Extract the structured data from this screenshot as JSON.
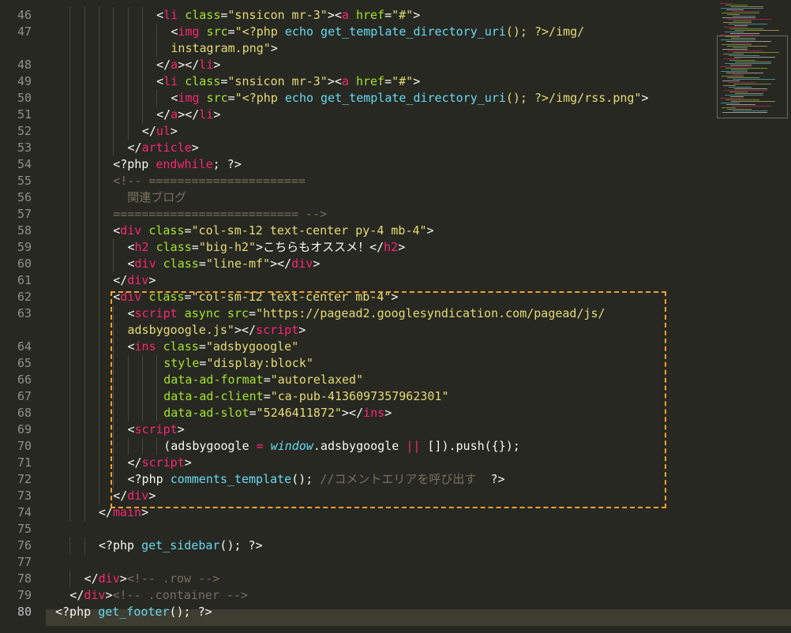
{
  "editor": {
    "line_numbers": [
      "46",
      "47",
      "",
      "48",
      "49",
      "50",
      "51",
      "52",
      "53",
      "54",
      "55",
      "56",
      "57",
      "58",
      "59",
      "60",
      "61",
      "62",
      "63",
      "",
      "64",
      "65",
      "66",
      "67",
      "68",
      "69",
      "70",
      "71",
      "72",
      "73",
      "74",
      "75",
      "76",
      "77",
      "78",
      "79",
      "80"
    ],
    "current_line": "80"
  },
  "code": [
    {
      "indent": 14,
      "tokens": [
        [
          "w",
          "<"
        ],
        [
          "t",
          "li"
        ],
        [
          "a",
          " class"
        ],
        [
          "w",
          "="
        ],
        [
          "s",
          "\"snsicon mr-3\""
        ],
        [
          "w",
          "><"
        ],
        [
          "t",
          "a"
        ],
        [
          "a",
          " href"
        ],
        [
          "w",
          "="
        ],
        [
          "s",
          "\"#\""
        ],
        [
          "w",
          ">"
        ]
      ]
    },
    {
      "indent": 16,
      "tokens": [
        [
          "w",
          "<"
        ],
        [
          "t",
          "img"
        ],
        [
          "a",
          " src"
        ],
        [
          "w",
          "="
        ],
        [
          "s",
          "\"<?php "
        ],
        [
          "f",
          "echo"
        ],
        [
          "s",
          " "
        ],
        [
          "f",
          "get_template_directory_uri"
        ],
        [
          "s",
          "(); ?>/img/"
        ]
      ]
    },
    {
      "indent": 16,
      "tokens": [
        [
          "s",
          "instagram.png\""
        ],
        [
          "w",
          ">"
        ]
      ]
    },
    {
      "indent": 14,
      "tokens": [
        [
          "w",
          "</"
        ],
        [
          "t",
          "a"
        ],
        [
          "w",
          "></"
        ],
        [
          "t",
          "li"
        ],
        [
          "w",
          ">"
        ]
      ]
    },
    {
      "indent": 14,
      "tokens": [
        [
          "w",
          "<"
        ],
        [
          "t",
          "li"
        ],
        [
          "a",
          " class"
        ],
        [
          "w",
          "="
        ],
        [
          "s",
          "\"snsicon mr-3\""
        ],
        [
          "w",
          "><"
        ],
        [
          "t",
          "a"
        ],
        [
          "a",
          " href"
        ],
        [
          "w",
          "="
        ],
        [
          "s",
          "\"#\""
        ],
        [
          "w",
          ">"
        ]
      ]
    },
    {
      "indent": 16,
      "tokens": [
        [
          "w",
          "<"
        ],
        [
          "t",
          "img"
        ],
        [
          "a",
          " src"
        ],
        [
          "w",
          "="
        ],
        [
          "s",
          "\"<?php "
        ],
        [
          "f",
          "echo"
        ],
        [
          "s",
          " "
        ],
        [
          "f",
          "get_template_directory_uri"
        ],
        [
          "s",
          "(); ?>/img/rss.png\""
        ],
        [
          "w",
          ">"
        ]
      ]
    },
    {
      "indent": 14,
      "tokens": [
        [
          "w",
          "</"
        ],
        [
          "t",
          "a"
        ],
        [
          "w",
          "></"
        ],
        [
          "t",
          "li"
        ],
        [
          "w",
          ">"
        ]
      ]
    },
    {
      "indent": 12,
      "tokens": [
        [
          "w",
          "</"
        ],
        [
          "t",
          "ul"
        ],
        [
          "w",
          ">"
        ]
      ]
    },
    {
      "indent": 10,
      "tokens": [
        [
          "w",
          "</"
        ],
        [
          "t",
          "article"
        ],
        [
          "w",
          ">"
        ]
      ]
    },
    {
      "indent": 8,
      "tokens": [
        [
          "w",
          "<?php "
        ],
        [
          "t",
          "endwhile"
        ],
        [
          "w",
          "; ?>"
        ]
      ]
    },
    {
      "indent": 8,
      "tokens": [
        [
          "c",
          "<!-- ======================"
        ]
      ]
    },
    {
      "indent": 8,
      "tokens": [
        [
          "c",
          "  関連ブログ"
        ]
      ]
    },
    {
      "indent": 8,
      "tokens": [
        [
          "c",
          "========================== -->"
        ]
      ]
    },
    {
      "indent": 8,
      "tokens": [
        [
          "w",
          "<"
        ],
        [
          "t",
          "div"
        ],
        [
          "a",
          " class"
        ],
        [
          "w",
          "="
        ],
        [
          "s",
          "\"col-sm-12 text-center py-4 mb-4\""
        ],
        [
          "w",
          ">"
        ]
      ]
    },
    {
      "indent": 10,
      "tokens": [
        [
          "w",
          "<"
        ],
        [
          "t",
          "h2"
        ],
        [
          "a",
          " class"
        ],
        [
          "w",
          "="
        ],
        [
          "s",
          "\"big-h2\""
        ],
        [
          "w",
          ">こちらもオススメ！</"
        ],
        [
          "t",
          "h2"
        ],
        [
          "w",
          ">"
        ]
      ]
    },
    {
      "indent": 10,
      "tokens": [
        [
          "w",
          "<"
        ],
        [
          "t",
          "div"
        ],
        [
          "a",
          " class"
        ],
        [
          "w",
          "="
        ],
        [
          "s",
          "\"line-mf\""
        ],
        [
          "w",
          "></"
        ],
        [
          "t",
          "div"
        ],
        [
          "w",
          ">"
        ]
      ]
    },
    {
      "indent": 8,
      "tokens": [
        [
          "w",
          "</"
        ],
        [
          "t",
          "div"
        ],
        [
          "w",
          ">"
        ]
      ]
    },
    {
      "indent": 8,
      "tokens": [
        [
          "w",
          "<"
        ],
        [
          "t",
          "div"
        ],
        [
          "a",
          " class"
        ],
        [
          "w",
          "="
        ],
        [
          "s",
          "\"col-sm-12 text-center mb-4\""
        ],
        [
          "w",
          ">"
        ]
      ]
    },
    {
      "indent": 10,
      "tokens": [
        [
          "w",
          "<"
        ],
        [
          "t",
          "script"
        ],
        [
          "a",
          " async src"
        ],
        [
          "w",
          "="
        ],
        [
          "s",
          "\"https://pagead2.googlesyndication.com/pagead/js/"
        ]
      ]
    },
    {
      "indent": 10,
      "tokens": [
        [
          "s",
          "adsbygoogle.js\""
        ],
        [
          "w",
          "></"
        ],
        [
          "t",
          "script"
        ],
        [
          "w",
          ">"
        ]
      ]
    },
    {
      "indent": 10,
      "tokens": [
        [
          "w",
          "<"
        ],
        [
          "t",
          "ins"
        ],
        [
          "a",
          " class"
        ],
        [
          "w",
          "="
        ],
        [
          "s",
          "\"adsbygoogle\""
        ]
      ]
    },
    {
      "indent": 15,
      "tokens": [
        [
          "a",
          "style"
        ],
        [
          "w",
          "="
        ],
        [
          "s",
          "\"display:block\""
        ]
      ]
    },
    {
      "indent": 15,
      "tokens": [
        [
          "a",
          "data-ad-format"
        ],
        [
          "w",
          "="
        ],
        [
          "s",
          "\"autorelaxed\""
        ]
      ]
    },
    {
      "indent": 15,
      "tokens": [
        [
          "a",
          "data-ad-client"
        ],
        [
          "w",
          "="
        ],
        [
          "s",
          "\"ca-pub-4136097357962301\""
        ]
      ]
    },
    {
      "indent": 15,
      "tokens": [
        [
          "a",
          "data-ad-slot"
        ],
        [
          "w",
          "="
        ],
        [
          "s",
          "\"5246411872\""
        ],
        [
          "w",
          "></"
        ],
        [
          "t",
          "ins"
        ],
        [
          "w",
          ">"
        ]
      ]
    },
    {
      "indent": 10,
      "tokens": [
        [
          "w",
          "<"
        ],
        [
          "t",
          "script"
        ],
        [
          "w",
          ">"
        ]
      ]
    },
    {
      "indent": 15,
      "tokens": [
        [
          "w",
          "(adsbygoogle "
        ],
        [
          "t",
          "="
        ],
        [
          "w",
          " "
        ],
        [
          "i",
          "window"
        ],
        [
          "w",
          ".adsbygoogle "
        ],
        [
          "t",
          "||"
        ],
        [
          "w",
          " []).push({});"
        ]
      ]
    },
    {
      "indent": 10,
      "tokens": [
        [
          "w",
          "</"
        ],
        [
          "t",
          "script"
        ],
        [
          "w",
          ">"
        ]
      ]
    },
    {
      "indent": 10,
      "tokens": [
        [
          "w",
          "<?php "
        ],
        [
          "f",
          "comments_template"
        ],
        [
          "w",
          "(); "
        ],
        [
          "c",
          "//コメントエリアを呼び出す  "
        ],
        [
          "w",
          "?>"
        ]
      ]
    },
    {
      "indent": 8,
      "tokens": [
        [
          "w",
          "</"
        ],
        [
          "t",
          "div"
        ],
        [
          "w",
          ">"
        ]
      ]
    },
    {
      "indent": 6,
      "tokens": [
        [
          "w",
          "</"
        ],
        [
          "t",
          "main"
        ],
        [
          "w",
          ">"
        ]
      ]
    },
    {
      "indent": 0,
      "tokens": []
    },
    {
      "indent": 6,
      "tokens": [
        [
          "w",
          "<?php "
        ],
        [
          "f",
          "get_sidebar"
        ],
        [
          "w",
          "(); ?>"
        ]
      ]
    },
    {
      "indent": 0,
      "tokens": []
    },
    {
      "indent": 4,
      "tokens": [
        [
          "w",
          "</"
        ],
        [
          "t",
          "div"
        ],
        [
          "w",
          ">"
        ],
        [
          "c",
          "<!-- .row -->"
        ]
      ]
    },
    {
      "indent": 2,
      "tokens": [
        [
          "w",
          "</"
        ],
        [
          "t",
          "div"
        ],
        [
          "w",
          ">"
        ],
        [
          "c",
          "<!-- .container -->"
        ]
      ]
    },
    {
      "indent": 0,
      "tokens": [
        [
          "w",
          "<?php "
        ],
        [
          "f",
          "get_footer"
        ],
        [
          "w",
          "(); ?>"
        ]
      ]
    }
  ],
  "colors": {
    "background": "#272822",
    "tag": "#f92672",
    "attribute": "#a6e22e",
    "string": "#e6db74",
    "comment": "#75715e",
    "function": "#66d9ef",
    "highlight_box": "#f0a030"
  }
}
